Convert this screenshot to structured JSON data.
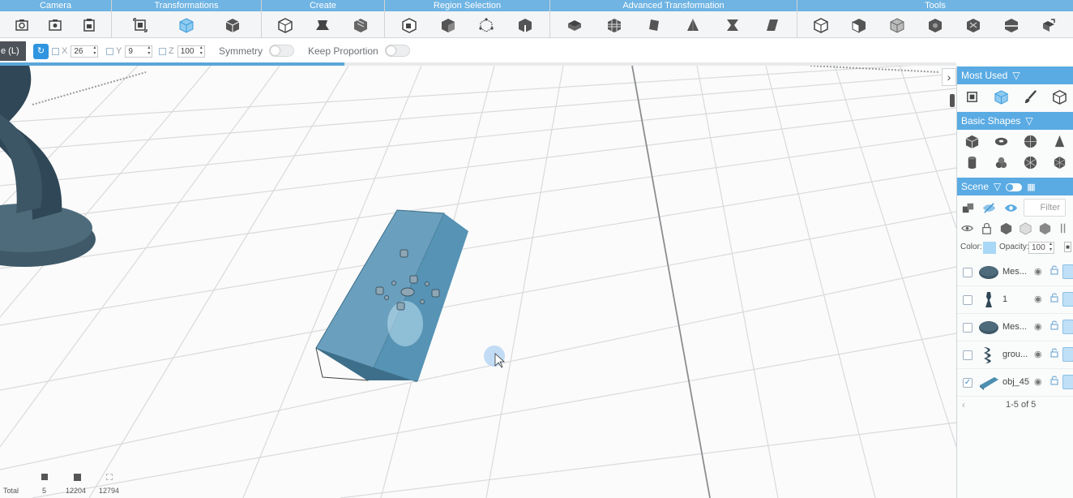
{
  "toolbar": {
    "groups": [
      {
        "name": "Camera",
        "icons": [
          "camera-reset-icon",
          "camera-fit-icon",
          "camera-screenshot-icon"
        ]
      },
      {
        "name": "Transformations",
        "icons": [
          "move-icon",
          "scale-icon",
          "rotate-icon"
        ]
      },
      {
        "name": "Create",
        "icons": [
          "box-create-icon",
          "extrude-icon",
          "loft-icon"
        ]
      },
      {
        "name": "Region Selection",
        "icons": [
          "select-region-icon",
          "select-face-icon",
          "select-vertex-icon",
          "select-edge-icon"
        ]
      },
      {
        "name": "Advanced Transformation",
        "icons": [
          "bend-icon",
          "twist-icon",
          "taper-icon",
          "pyramid-icon",
          "pinch-icon",
          "skew-icon"
        ]
      },
      {
        "name": "Tools",
        "icons": [
          "boolean-icon",
          "hollow-icon",
          "shell-icon",
          "sphere-tool-icon",
          "repair-icon",
          "cut-icon",
          "smooth-icon"
        ]
      }
    ]
  },
  "options": {
    "mode_tab": "e (L)",
    "x_label": "X",
    "x_value": "26",
    "y_label": "Y",
    "y_value": "9",
    "z_label": "Z",
    "z_value": "100",
    "symmetry_label": "Symmetry",
    "keep_proportion_label": "Keep Proportion",
    "progress_fraction": 0.36
  },
  "panel": {
    "most_used_label": "Most Used",
    "basic_shapes_label": "Basic Shapes",
    "scene_label": "Scene",
    "filter_placeholder": "Filter",
    "color_label": "Color:",
    "color_value": "#a8d8f5",
    "opacity_label": "Opacity:",
    "opacity_value": "100",
    "objects": [
      {
        "name": "Mes...",
        "checked": false,
        "thumb": "disc"
      },
      {
        "name": "1",
        "checked": false,
        "thumb": "figure"
      },
      {
        "name": "Mes...",
        "checked": false,
        "thumb": "disc"
      },
      {
        "name": "grou...",
        "checked": false,
        "thumb": "spiral"
      },
      {
        "name": "obj_45",
        "checked": true,
        "thumb": "slab"
      }
    ],
    "pagination": "1-5 of 5"
  },
  "stats": {
    "total_label": "Total",
    "values": [
      "5",
      "12204",
      "12794"
    ]
  },
  "colors": {
    "accent": "#5aabe3",
    "model": "#4d8fb0"
  }
}
